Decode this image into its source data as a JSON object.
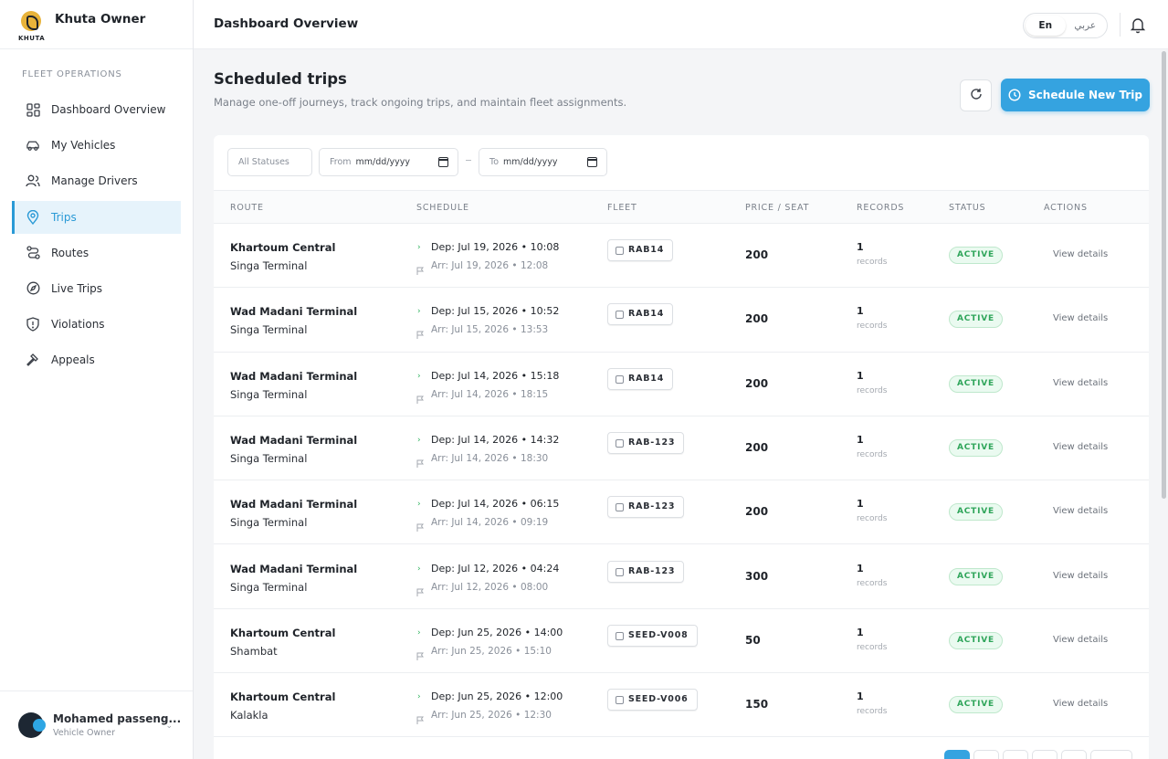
{
  "app": {
    "brand_name": "Khuta Owner",
    "logo_text": "KHUTA"
  },
  "sidebar": {
    "section_label": "FLEET OPERATIONS",
    "items": [
      {
        "label": "Dashboard Overview",
        "icon": "grid-icon"
      },
      {
        "label": "My Vehicles",
        "icon": "car-icon"
      },
      {
        "label": "Manage Drivers",
        "icon": "users-icon"
      },
      {
        "label": "Trips",
        "icon": "map-pin-icon",
        "active": true
      },
      {
        "label": "Routes",
        "icon": "route-icon"
      },
      {
        "label": "Live Trips",
        "icon": "compass-icon"
      },
      {
        "label": "Violations",
        "icon": "shield-alert-icon"
      },
      {
        "label": "Appeals",
        "icon": "gavel-icon"
      }
    ],
    "user": {
      "name": "Mohamed passeng...",
      "role": "Vehicle Owner"
    }
  },
  "header": {
    "title": "Dashboard Overview",
    "lang_en": "En",
    "lang_ar": "عربي"
  },
  "main": {
    "title": "Scheduled trips",
    "subtitle": "Manage one-off journeys, track ongoing trips, and maintain fleet assignments.",
    "primary_button": "Schedule New Trip",
    "filters": {
      "status": "All Statuses",
      "from_prefix": "From",
      "from_placeholder": "mm/dd/yyyy",
      "to_prefix": "To",
      "to_placeholder": "mm/dd/yyyy"
    },
    "columns": [
      "ROUTE",
      "SCHEDULE",
      "FLEET",
      "PRICE / SEAT",
      "RECORDS",
      "STATUS",
      "ACTIONS"
    ],
    "rows": [
      {
        "from": "Khartoum Central",
        "to": "Singa Terminal",
        "dep": "Dep: Jul 19, 2026 • 10:08",
        "arr": "Arr: Jul 19, 2026 • 12:08",
        "fleet": "RAB14",
        "price": "200",
        "records": "1",
        "records_label": "records",
        "status": "ACTIVE",
        "action": "View details"
      },
      {
        "from": "Wad Madani Terminal",
        "to": "Singa Terminal",
        "dep": "Dep: Jul 15, 2026 • 10:52",
        "arr": "Arr: Jul 15, 2026 • 13:53",
        "fleet": "RAB14",
        "price": "200",
        "records": "1",
        "records_label": "records",
        "status": "ACTIVE",
        "action": "View details"
      },
      {
        "from": "Wad Madani Terminal",
        "to": "Singa Terminal",
        "dep": "Dep: Jul 14, 2026 • 15:18",
        "arr": "Arr: Jul 14, 2026 • 18:15",
        "fleet": "RAB14",
        "price": "200",
        "records": "1",
        "records_label": "records",
        "status": "ACTIVE",
        "action": "View details"
      },
      {
        "from": "Wad Madani Terminal",
        "to": "Singa Terminal",
        "dep": "Dep: Jul 14, 2026 • 14:32",
        "arr": "Arr: Jul 14, 2026 • 18:30",
        "fleet": "RAB-123",
        "price": "200",
        "records": "1",
        "records_label": "records",
        "status": "ACTIVE",
        "action": "View details"
      },
      {
        "from": "Wad Madani Terminal",
        "to": "Singa Terminal",
        "dep": "Dep: Jul 14, 2026 • 06:15",
        "arr": "Arr: Jul 14, 2026 • 09:19",
        "fleet": "RAB-123",
        "price": "200",
        "records": "1",
        "records_label": "records",
        "status": "ACTIVE",
        "action": "View details"
      },
      {
        "from": "Wad Madani Terminal",
        "to": "Singa Terminal",
        "dep": "Dep: Jul 12, 2026 • 04:24",
        "arr": "Arr: Jul 12, 2026 • 08:00",
        "fleet": "RAB-123",
        "price": "300",
        "records": "1",
        "records_label": "records",
        "status": "ACTIVE",
        "action": "View details"
      },
      {
        "from": "Khartoum Central",
        "to": "Shambat",
        "dep": "Dep: Jun 25, 2026 • 14:00",
        "arr": "Arr: Jun 25, 2026 • 15:10",
        "fleet": "SEED-V008",
        "price": "50",
        "records": "1",
        "records_label": "records",
        "status": "ACTIVE",
        "action": "View details"
      },
      {
        "from": "Khartoum Central",
        "to": "Kalakla",
        "dep": "Dep: Jun 25, 2026 • 12:00",
        "arr": "Arr: Jun 25, 2026 • 12:30",
        "fleet": "SEED-V006",
        "price": "150",
        "records": "1",
        "records_label": "records",
        "status": "ACTIVE",
        "action": "View details"
      }
    ]
  },
  "colors": {
    "accent": "#35a3e0",
    "active_nav_bg": "#e6f3fb",
    "status_active": "#2fa55a",
    "status_active_bg": "#eafaf0"
  }
}
